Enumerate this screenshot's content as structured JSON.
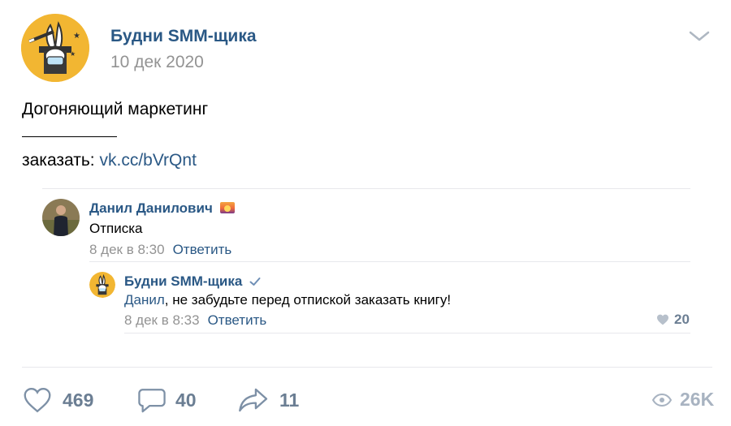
{
  "post": {
    "author": "Будни SMM-щика",
    "date": "10 дек 2020",
    "title": "Догоняющий маркетинг",
    "order_label": "заказать:",
    "order_link": "vk.cc/bVrQnt",
    "accent": "#2a5885"
  },
  "comments": [
    {
      "author": "Данил Данилович",
      "badge_icon": "sunset-emoji-icon",
      "text": "Отписка",
      "time": "8 дек в 8:30",
      "reply_label": "Ответить"
    }
  ],
  "reply": {
    "author": "Будни SMM-щика",
    "verified_icon": "check-icon",
    "mention": "Данил",
    "text": ", не забудьте перед отпиской заказать книгу!",
    "time": "8 дек в 8:33",
    "reply_label": "Ответить",
    "likes": "20"
  },
  "footer": {
    "likes": "469",
    "comments": "40",
    "shares": "11",
    "views": "26K"
  }
}
